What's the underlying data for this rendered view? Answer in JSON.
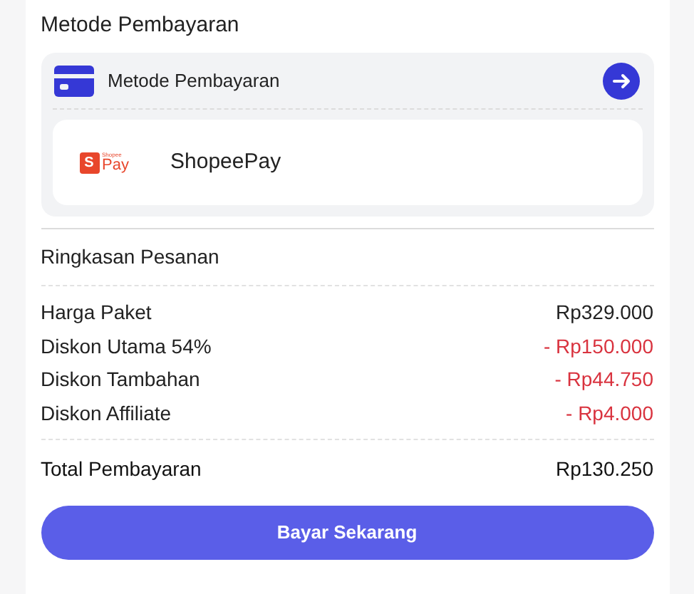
{
  "payment_section": {
    "title": "Metode Pembayaran",
    "selector_label": "Metode Pembayaran",
    "selected_method": {
      "name": "ShopeePay",
      "logo": {
        "mark": "S",
        "brand_small": "Shopee",
        "brand_word": "Pay"
      }
    }
  },
  "summary": {
    "title": "Ringkasan Pesanan",
    "rows": [
      {
        "label": "Harga Paket",
        "value": "Rp329.000",
        "kind": "price"
      },
      {
        "label": "Diskon Utama 54%",
        "value": "- Rp150.000",
        "kind": "discount"
      },
      {
        "label": "Diskon Tambahan",
        "value": "- Rp44.750",
        "kind": "discount"
      },
      {
        "label": "Diskon Affiliate",
        "value": "- Rp4.000",
        "kind": "discount"
      }
    ],
    "total_label": "Total Pembayaran",
    "total_value": "Rp130.250"
  },
  "pay_button": "Bayar Sekarang"
}
